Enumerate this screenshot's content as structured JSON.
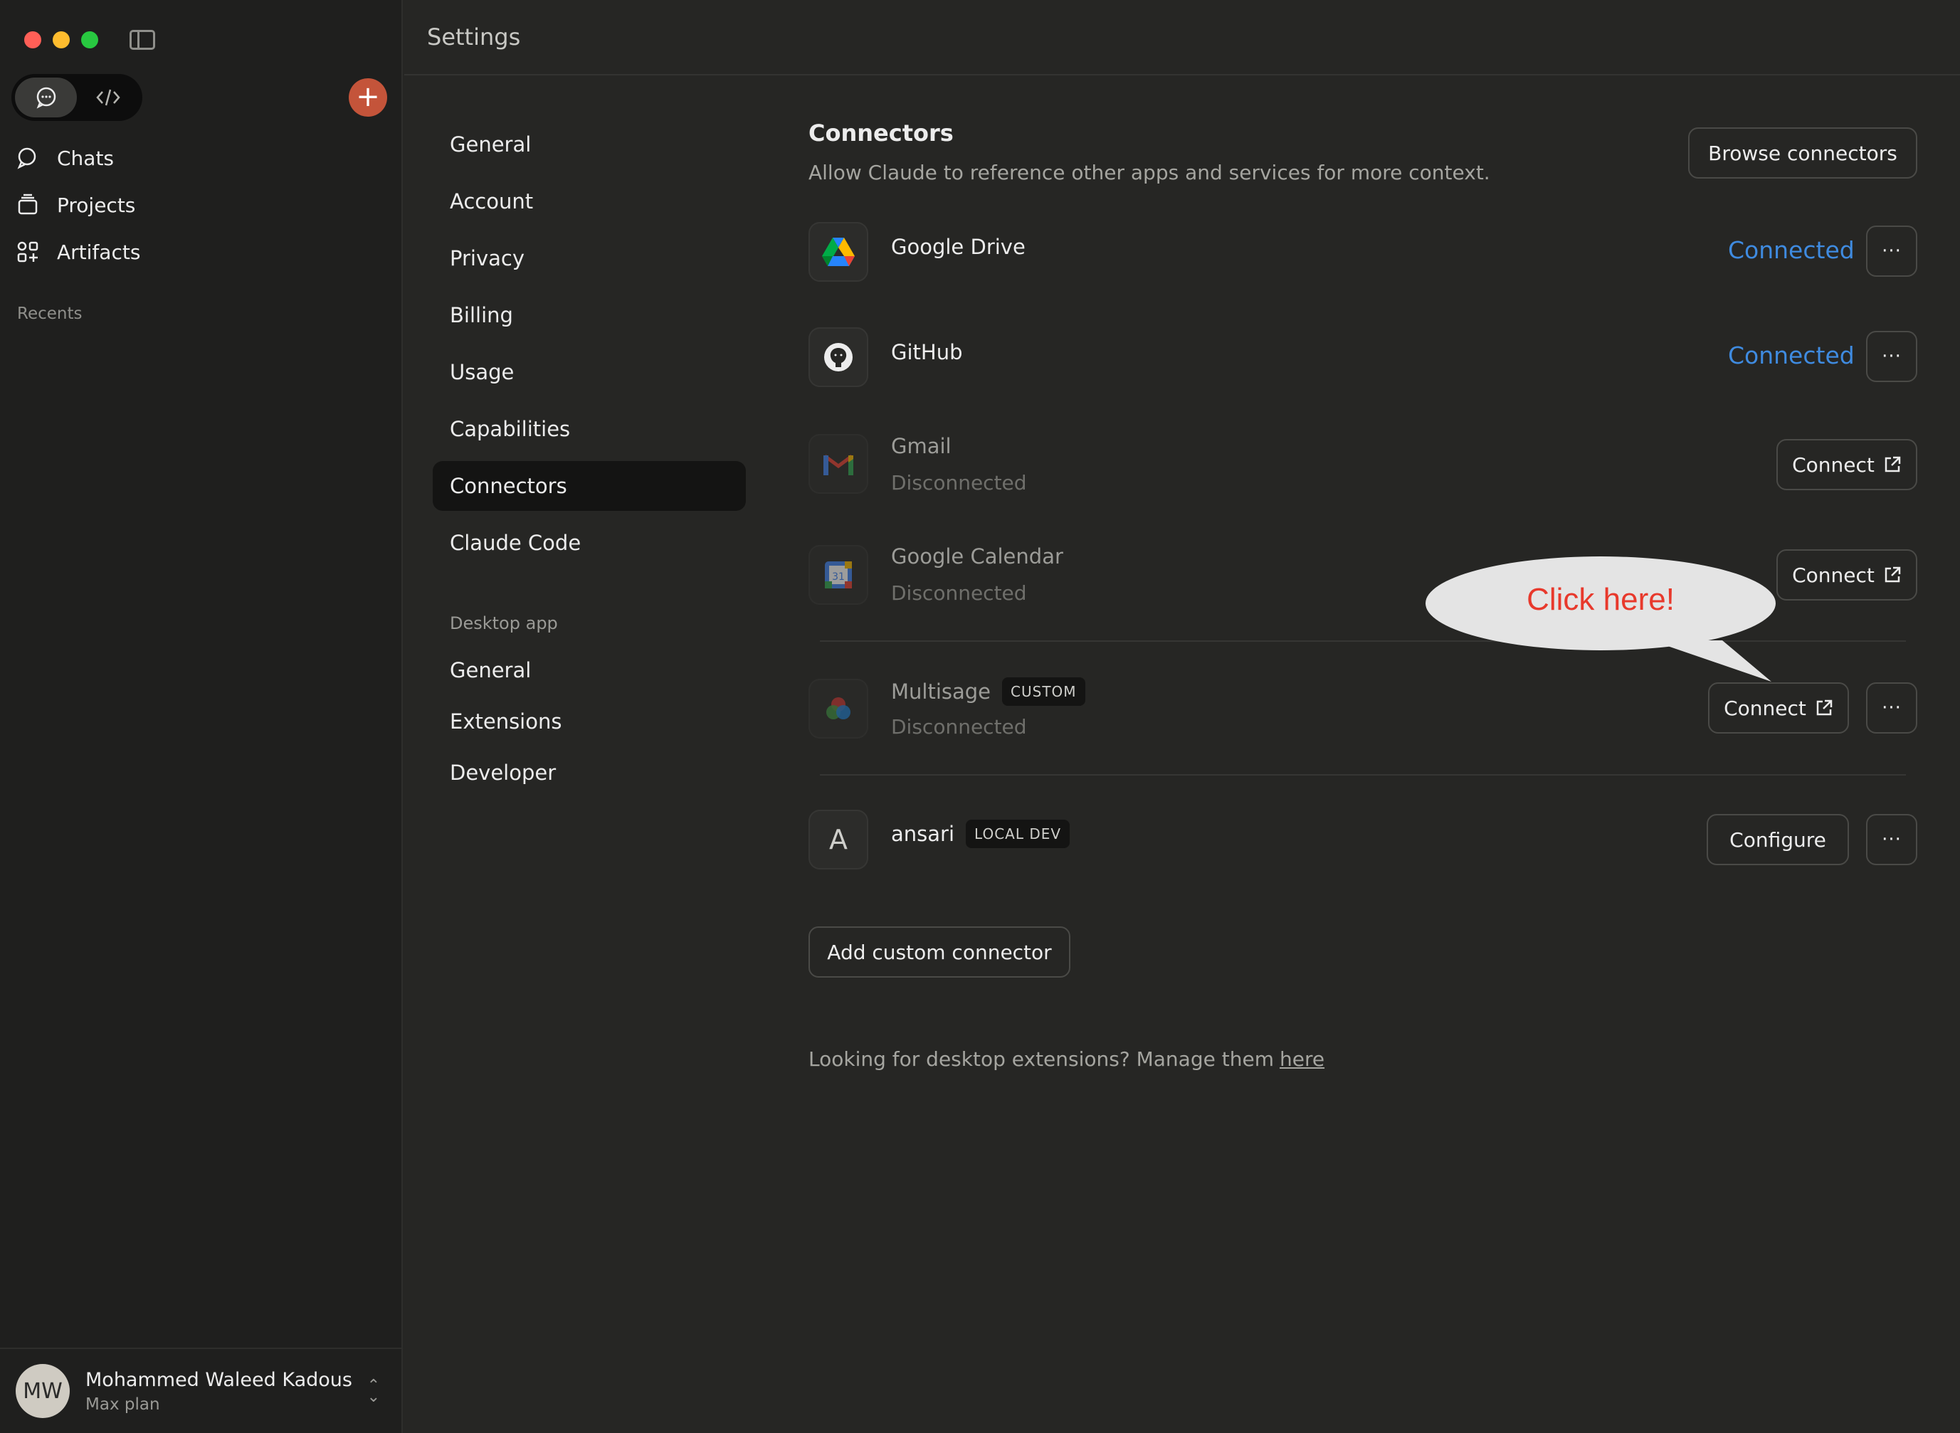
{
  "window": {
    "title": "Settings"
  },
  "sidebar": {
    "modes": [
      {
        "name": "chat",
        "icon": "chat-bubble-icon"
      },
      {
        "name": "code",
        "icon": "code-icon"
      }
    ],
    "nav": [
      {
        "label": "Chats",
        "icon": "chat-icon"
      },
      {
        "label": "Projects",
        "icon": "projects-icon"
      },
      {
        "label": "Artifacts",
        "icon": "artifacts-icon"
      }
    ],
    "recents_label": "Recents",
    "user": {
      "initials": "MW",
      "name": "Mohammed Waleed Kadous",
      "plan": "Max plan"
    }
  },
  "settings_nav": {
    "items": [
      "General",
      "Account",
      "Privacy",
      "Billing",
      "Usage",
      "Capabilities",
      "Connectors",
      "Claude Code"
    ],
    "active": "Connectors",
    "desktop_section_label": "Desktop app",
    "desktop_items": [
      "General",
      "Extensions",
      "Developer"
    ]
  },
  "connectors": {
    "title": "Connectors",
    "subtitle": "Allow Claude to reference other apps and services for more context.",
    "browse_label": "Browse connectors",
    "items": [
      {
        "name": "Google Drive",
        "status": "Connected",
        "icon": "google-drive-icon"
      },
      {
        "name": "GitHub",
        "status": "Connected",
        "icon": "github-icon"
      },
      {
        "name": "Gmail",
        "status": "Disconnected",
        "action": "Connect",
        "icon": "gmail-icon"
      },
      {
        "name": "Google Calendar",
        "status": "Disconnected",
        "action": "Connect",
        "icon": "google-calendar-icon",
        "calendar_day": "31"
      },
      {
        "name": "Multisage",
        "badge": "CUSTOM",
        "status": "Disconnected",
        "action": "Connect",
        "icon": "multisage-icon"
      },
      {
        "name": "ansari",
        "badge": "LOCAL DEV",
        "action": "Configure",
        "icon_letter": "A"
      }
    ],
    "more_label": "···",
    "add_custom_label": "Add custom connector",
    "footnote_text": "Looking for desktop extensions? Manage them",
    "footnote_link": "here"
  },
  "annotation": {
    "text": "Click here!"
  },
  "colors": {
    "accent_connected": "#3f8be0",
    "new_chat": "#c4543a",
    "annotation_text": "#e8392c"
  }
}
